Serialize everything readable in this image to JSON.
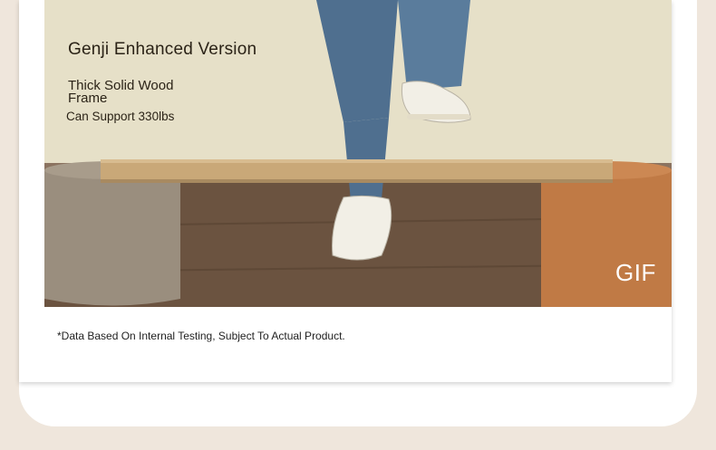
{
  "product_card": {
    "title": "Genji Enhanced Version",
    "feature_line_1": "Thick Solid Wood",
    "feature_line_2": "Frame",
    "capacity": "Can Support 330lbs",
    "media_badge": "GIF",
    "disclaimer": "*Data Based On Internal Testing, Subject To Actual Product."
  },
  "colors": {
    "page_background": "#efe6dc",
    "card_background": "#ffffff",
    "text_dark": "#2b2317",
    "wood_plank": "#c9a878",
    "left_stool": "#9a8e7e",
    "right_stool": "#c07a45"
  }
}
